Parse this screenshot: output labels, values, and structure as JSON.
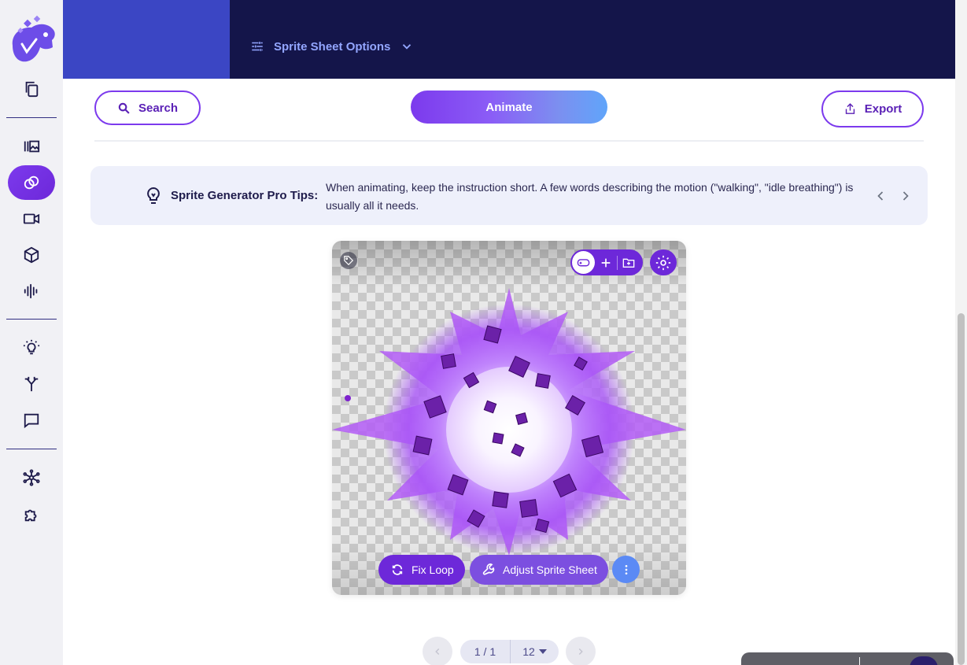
{
  "header": {
    "options_label": "Sprite Sheet Options"
  },
  "toolbar": {
    "search_label": "Search",
    "animate_label": "Animate",
    "export_label": "Export"
  },
  "tips": {
    "title": "Sprite Generator Pro Tips:",
    "text": "When animating, keep the instruction short. A few words describing the motion (\"walking\", \"idle breathing\") is usually all it needs."
  },
  "card": {
    "fix_loop_label": "Fix Loop",
    "adjust_label": "Adjust Sprite Sheet"
  },
  "pagination": {
    "page": "1 / 1",
    "page_size": "12"
  },
  "sidebar": {
    "icons": [
      "copy-icon",
      "gallery-icon",
      "sprite-link-icon",
      "video-icon",
      "cube-icon",
      "audio-wave-icon",
      "lightbulb-icon",
      "merge-icon",
      "chat-icon",
      "network-icon",
      "puzzle-icon"
    ],
    "active": "sprite-link-icon"
  },
  "colors": {
    "header_bg": "#14154a",
    "accent": "#7c3aed",
    "sidebar_bg": "#f1f1f5",
    "tips_bg": "#eef0fb",
    "link": "#93a6ff"
  }
}
